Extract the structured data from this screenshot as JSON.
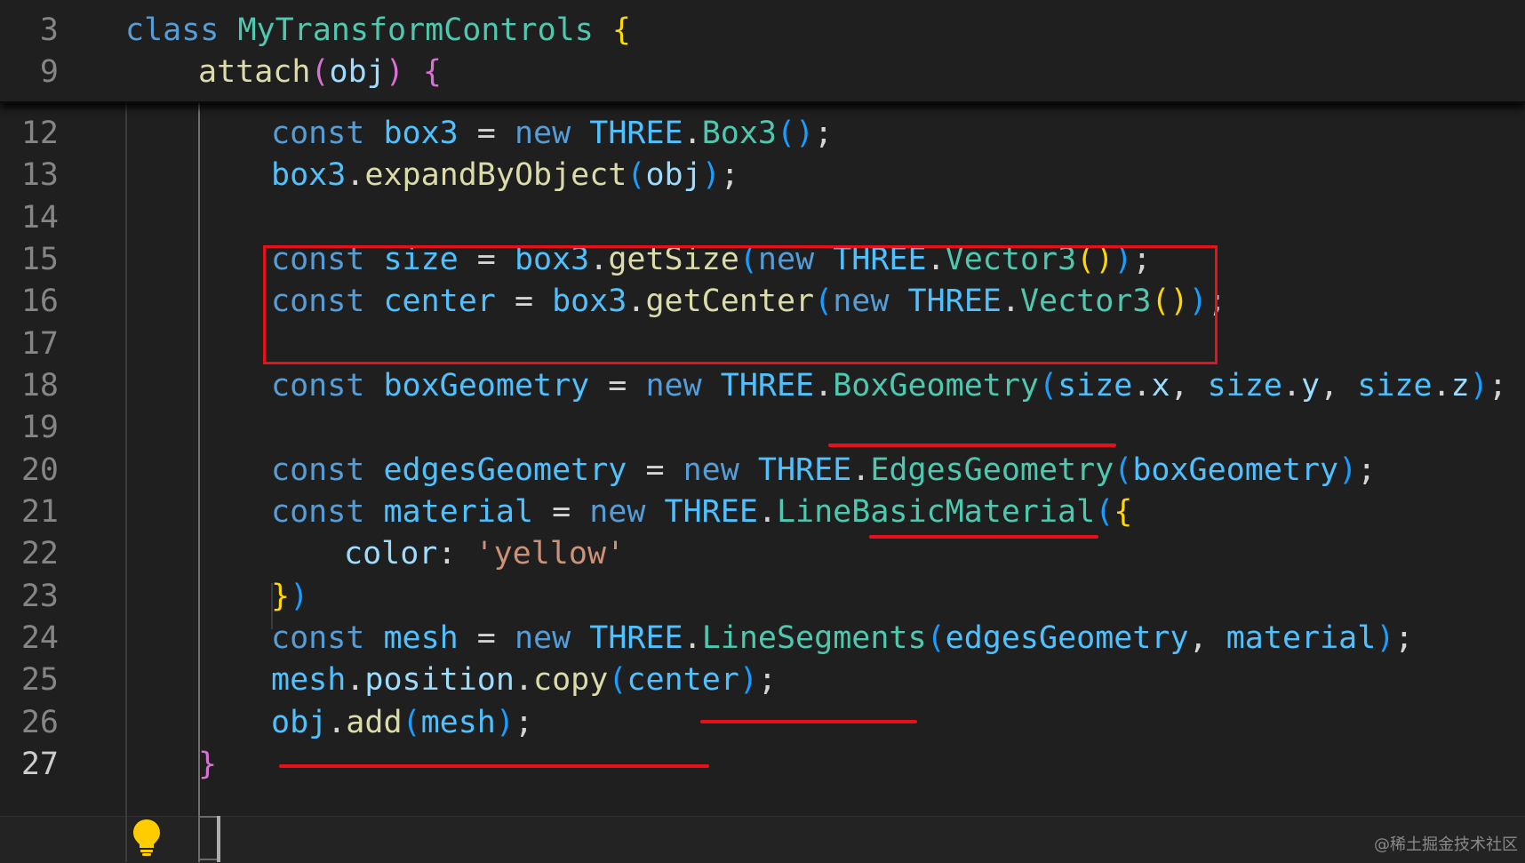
{
  "sticky": [
    {
      "num": "3",
      "indent": 0,
      "tokens": [
        {
          "t": "class",
          "c": "t-kw"
        },
        {
          "t": " ",
          "c": ""
        },
        {
          "t": "MyTransformControls",
          "c": "t-cls"
        },
        {
          "t": " ",
          "c": ""
        },
        {
          "t": "{",
          "c": "b-gold"
        }
      ]
    },
    {
      "num": "9",
      "indent": 1,
      "tokens": [
        {
          "t": "attach",
          "c": "t-fn"
        },
        {
          "t": "(",
          "c": "b-pink"
        },
        {
          "t": "obj",
          "c": "t-prop"
        },
        {
          "t": ")",
          "c": "b-pink"
        },
        {
          "t": " ",
          "c": ""
        },
        {
          "t": "{",
          "c": "b-pink"
        }
      ]
    }
  ],
  "lines": [
    {
      "num": "12",
      "indent": 2,
      "tokens": [
        {
          "t": "const",
          "c": "t-kw"
        },
        {
          "t": " ",
          "c": ""
        },
        {
          "t": "box3",
          "c": "t-var"
        },
        {
          "t": " = ",
          "c": "t-p"
        },
        {
          "t": "new",
          "c": "t-kw"
        },
        {
          "t": " ",
          "c": ""
        },
        {
          "t": "THREE",
          "c": "t-var"
        },
        {
          "t": ".",
          "c": "t-p"
        },
        {
          "t": "Box3",
          "c": "t-cls"
        },
        {
          "t": "()",
          "c": "b-blue"
        },
        {
          "t": ";",
          "c": "t-p"
        }
      ]
    },
    {
      "num": "13",
      "indent": 2,
      "tokens": [
        {
          "t": "box3",
          "c": "t-var"
        },
        {
          "t": ".",
          "c": "t-p"
        },
        {
          "t": "expandByObject",
          "c": "t-fn"
        },
        {
          "t": "(",
          "c": "b-blue"
        },
        {
          "t": "obj",
          "c": "t-prop"
        },
        {
          "t": ")",
          "c": "b-blue"
        },
        {
          "t": ";",
          "c": "t-p"
        }
      ]
    },
    {
      "num": "14",
      "indent": 2,
      "tokens": []
    },
    {
      "num": "15",
      "indent": 2,
      "tokens": [
        {
          "t": "const",
          "c": "t-kw"
        },
        {
          "t": " ",
          "c": ""
        },
        {
          "t": "size",
          "c": "t-var"
        },
        {
          "t": " = ",
          "c": "t-p"
        },
        {
          "t": "box3",
          "c": "t-var"
        },
        {
          "t": ".",
          "c": "t-p"
        },
        {
          "t": "getSize",
          "c": "t-fn"
        },
        {
          "t": "(",
          "c": "b-blue"
        },
        {
          "t": "new",
          "c": "t-kw"
        },
        {
          "t": " ",
          "c": ""
        },
        {
          "t": "THREE",
          "c": "t-var"
        },
        {
          "t": ".",
          "c": "t-p"
        },
        {
          "t": "Vector3",
          "c": "t-cls"
        },
        {
          "t": "()",
          "c": "b-gold"
        },
        {
          "t": ")",
          "c": "b-blue"
        },
        {
          "t": ";",
          "c": "t-p"
        }
      ]
    },
    {
      "num": "16",
      "indent": 2,
      "tokens": [
        {
          "t": "const",
          "c": "t-kw"
        },
        {
          "t": " ",
          "c": ""
        },
        {
          "t": "center",
          "c": "t-var"
        },
        {
          "t": " = ",
          "c": "t-p"
        },
        {
          "t": "box3",
          "c": "t-var"
        },
        {
          "t": ".",
          "c": "t-p"
        },
        {
          "t": "getCenter",
          "c": "t-fn"
        },
        {
          "t": "(",
          "c": "b-blue"
        },
        {
          "t": "new",
          "c": "t-kw"
        },
        {
          "t": " ",
          "c": ""
        },
        {
          "t": "THREE",
          "c": "t-var"
        },
        {
          "t": ".",
          "c": "t-p"
        },
        {
          "t": "Vector3",
          "c": "t-cls"
        },
        {
          "t": "()",
          "c": "b-gold"
        },
        {
          "t": ")",
          "c": "b-blue"
        },
        {
          "t": ";",
          "c": "t-p"
        }
      ]
    },
    {
      "num": "17",
      "indent": 2,
      "tokens": []
    },
    {
      "num": "18",
      "indent": 2,
      "tokens": [
        {
          "t": "const",
          "c": "t-kw"
        },
        {
          "t": " ",
          "c": ""
        },
        {
          "t": "boxGeometry",
          "c": "t-var"
        },
        {
          "t": " = ",
          "c": "t-p"
        },
        {
          "t": "new",
          "c": "t-kw"
        },
        {
          "t": " ",
          "c": ""
        },
        {
          "t": "THREE",
          "c": "t-var"
        },
        {
          "t": ".",
          "c": "t-p"
        },
        {
          "t": "BoxGeometry",
          "c": "t-cls"
        },
        {
          "t": "(",
          "c": "b-blue"
        },
        {
          "t": "size",
          "c": "t-var"
        },
        {
          "t": ".",
          "c": "t-p"
        },
        {
          "t": "x",
          "c": "t-prop"
        },
        {
          "t": ", ",
          "c": "t-p"
        },
        {
          "t": "size",
          "c": "t-var"
        },
        {
          "t": ".",
          "c": "t-p"
        },
        {
          "t": "y",
          "c": "t-prop"
        },
        {
          "t": ", ",
          "c": "t-p"
        },
        {
          "t": "size",
          "c": "t-var"
        },
        {
          "t": ".",
          "c": "t-p"
        },
        {
          "t": "z",
          "c": "t-prop"
        },
        {
          "t": ")",
          "c": "b-blue"
        },
        {
          "t": ";",
          "c": "t-p"
        }
      ]
    },
    {
      "num": "19",
      "indent": 2,
      "tokens": []
    },
    {
      "num": "20",
      "indent": 2,
      "tokens": [
        {
          "t": "const",
          "c": "t-kw"
        },
        {
          "t": " ",
          "c": ""
        },
        {
          "t": "edgesGeometry",
          "c": "t-var"
        },
        {
          "t": " = ",
          "c": "t-p"
        },
        {
          "t": "new",
          "c": "t-kw"
        },
        {
          "t": " ",
          "c": ""
        },
        {
          "t": "THREE",
          "c": "t-var"
        },
        {
          "t": ".",
          "c": "t-p"
        },
        {
          "t": "EdgesGeometry",
          "c": "t-cls"
        },
        {
          "t": "(",
          "c": "b-blue"
        },
        {
          "t": "boxGeometry",
          "c": "t-var"
        },
        {
          "t": ")",
          "c": "b-blue"
        },
        {
          "t": ";",
          "c": "t-p"
        }
      ]
    },
    {
      "num": "21",
      "indent": 2,
      "tokens": [
        {
          "t": "const",
          "c": "t-kw"
        },
        {
          "t": " ",
          "c": ""
        },
        {
          "t": "material",
          "c": "t-var"
        },
        {
          "t": " = ",
          "c": "t-p"
        },
        {
          "t": "new",
          "c": "t-kw"
        },
        {
          "t": " ",
          "c": ""
        },
        {
          "t": "THREE",
          "c": "t-var"
        },
        {
          "t": ".",
          "c": "t-p"
        },
        {
          "t": "LineBasicMaterial",
          "c": "t-cls"
        },
        {
          "t": "(",
          "c": "b-blue"
        },
        {
          "t": "{",
          "c": "b-gold"
        }
      ]
    },
    {
      "num": "22",
      "indent": 3,
      "tokens": [
        {
          "t": "color",
          "c": "t-prop"
        },
        {
          "t": ": ",
          "c": "t-p"
        },
        {
          "t": "'yellow'",
          "c": "t-str"
        }
      ]
    },
    {
      "num": "23",
      "indent": 2,
      "tokens": [
        {
          "t": "}",
          "c": "b-gold"
        },
        {
          "t": ")",
          "c": "b-blue"
        }
      ]
    },
    {
      "num": "24",
      "indent": 2,
      "tokens": [
        {
          "t": "const",
          "c": "t-kw"
        },
        {
          "t": " ",
          "c": ""
        },
        {
          "t": "mesh",
          "c": "t-var"
        },
        {
          "t": " = ",
          "c": "t-p"
        },
        {
          "t": "new",
          "c": "t-kw"
        },
        {
          "t": " ",
          "c": ""
        },
        {
          "t": "THREE",
          "c": "t-var"
        },
        {
          "t": ".",
          "c": "t-p"
        },
        {
          "t": "LineSegments",
          "c": "t-cls"
        },
        {
          "t": "(",
          "c": "b-blue"
        },
        {
          "t": "edgesGeometry",
          "c": "t-var"
        },
        {
          "t": ", ",
          "c": "t-p"
        },
        {
          "t": "material",
          "c": "t-var"
        },
        {
          "t": ")",
          "c": "b-blue"
        },
        {
          "t": ";",
          "c": "t-p"
        }
      ]
    },
    {
      "num": "25",
      "indent": 2,
      "tokens": [
        {
          "t": "mesh",
          "c": "t-var"
        },
        {
          "t": ".",
          "c": "t-p"
        },
        {
          "t": "position",
          "c": "t-prop"
        },
        {
          "t": ".",
          "c": "t-p"
        },
        {
          "t": "copy",
          "c": "t-fn"
        },
        {
          "t": "(",
          "c": "b-blue"
        },
        {
          "t": "center",
          "c": "t-var"
        },
        {
          "t": ")",
          "c": "b-blue"
        },
        {
          "t": ";",
          "c": "t-p"
        }
      ]
    },
    {
      "num": "26",
      "indent": 2,
      "tokens": [
        {
          "t": "obj",
          "c": "t-var"
        },
        {
          "t": ".",
          "c": "t-p"
        },
        {
          "t": "add",
          "c": "t-fn"
        },
        {
          "t": "(",
          "c": "b-blue"
        },
        {
          "t": "mesh",
          "c": "t-var"
        },
        {
          "t": ")",
          "c": "b-blue"
        },
        {
          "t": ";",
          "c": "t-p"
        }
      ]
    },
    {
      "num": "27",
      "indent": 1,
      "active": true,
      "tokens": [
        {
          "t": "}",
          "c": "b-pink"
        }
      ]
    }
  ],
  "watermark": "@稀土掘金技术社区"
}
